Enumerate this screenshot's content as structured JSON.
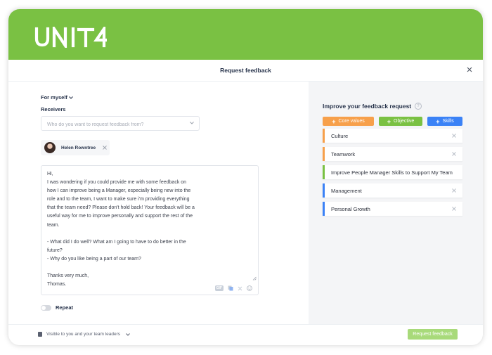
{
  "app": {
    "logo_text": "UNIT4",
    "brand_color": "#7ac143"
  },
  "modal": {
    "title": "Request feedback",
    "close_icon": "close-icon"
  },
  "form": {
    "audience_selector": "For myself",
    "receivers_label": "Receivers",
    "search_placeholder": "Who do you want to request feedback from?",
    "selected_receivers": [
      {
        "name": "Helen Rowntree"
      }
    ],
    "message": "Hi,\nI was wondering if you could provide me with some feedback on how I can improve being a Manager, especially being new into the role and to the team, I want to make sure i'm providing everything that the team need? Please don't hold back! Your feedback will be a useful way for me to improve personally and support the rest of the team.\n\n- What did I do well? What am I going to have to do better in the future?\n- Why do you like being a part of our team?\n\nThanks very much,\nThomas.",
    "toolbar": {
      "gif_label": "GIF"
    },
    "repeat_label": "Repeat",
    "repeat_enabled": false
  },
  "improve": {
    "title": "Improve your feedback request",
    "add_buttons": [
      {
        "label": "Core values",
        "color": "#f7a04b"
      },
      {
        "label": "Objective",
        "color": "#7ac143"
      },
      {
        "label": "Skills",
        "color": "#3b82f6"
      }
    ],
    "suggestions": [
      {
        "label": "Culture",
        "color": "#f7a04b",
        "removable": true
      },
      {
        "label": "Teamwork",
        "color": "#f7a04b",
        "removable": true
      },
      {
        "label": "Improve People Manager Skills to Support My Team",
        "color": "#7ac143",
        "removable": false
      },
      {
        "label": "Management",
        "color": "#3b82f6",
        "removable": true
      },
      {
        "label": "Personal Growth",
        "color": "#3b82f6",
        "removable": true
      }
    ]
  },
  "footer": {
    "visibility_label": "Visible to you and your team leaders",
    "submit_label": "Request feedback",
    "submit_color": "#a8da7a"
  }
}
